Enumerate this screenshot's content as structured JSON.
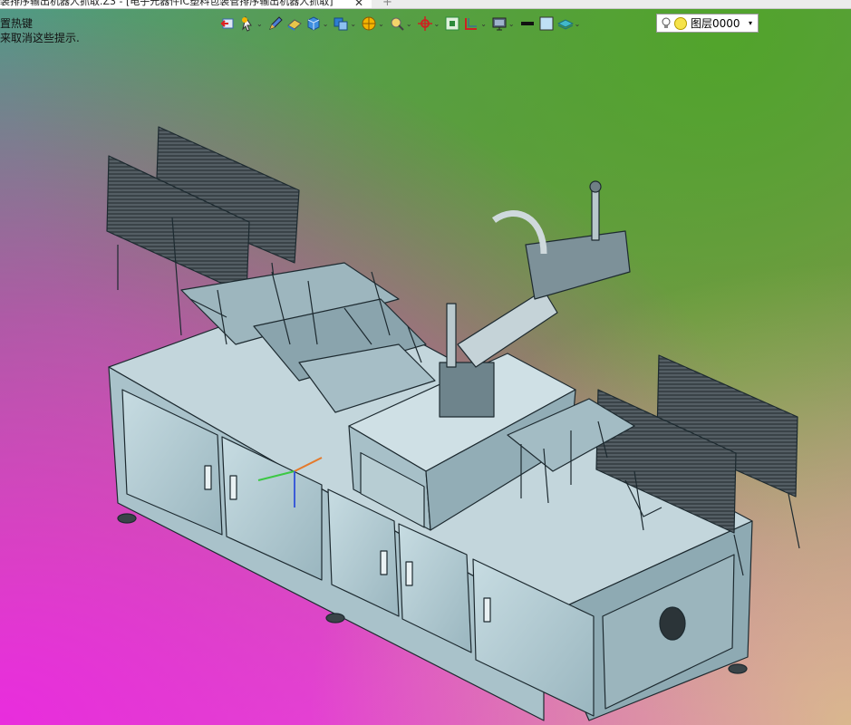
{
  "window": {
    "tab_title": "装排序输出机器人抓取.Z3 - [电子元器件IC塑料包装管排序输出机器人抓取]",
    "tab_close": "✕",
    "tab_add": "+"
  },
  "hints": [
    "置热键",
    "来取消这些提示."
  ],
  "toolbar": {
    "icons": [
      "exit-sketch-icon",
      "pointer-icon",
      "pen-icon",
      "eraser-icon",
      "cube-icon",
      "view-cube-icon",
      "render-icon",
      "zoom-icon",
      "axis-icon",
      "fit-icon",
      "section-icon",
      "display-icon",
      "line-weight-icon",
      "color-box-icon",
      "layer-stack-icon"
    ]
  },
  "layer": {
    "value": "图层0000",
    "dropdown_arrow": "▾"
  },
  "colors": {
    "machine_fill": "#b9cfd6",
    "machine_dark": "#8ea8b1",
    "machine_line": "#1d2a30",
    "accent_green": "#55a52a",
    "accent_pink": "#e43ad6"
  }
}
